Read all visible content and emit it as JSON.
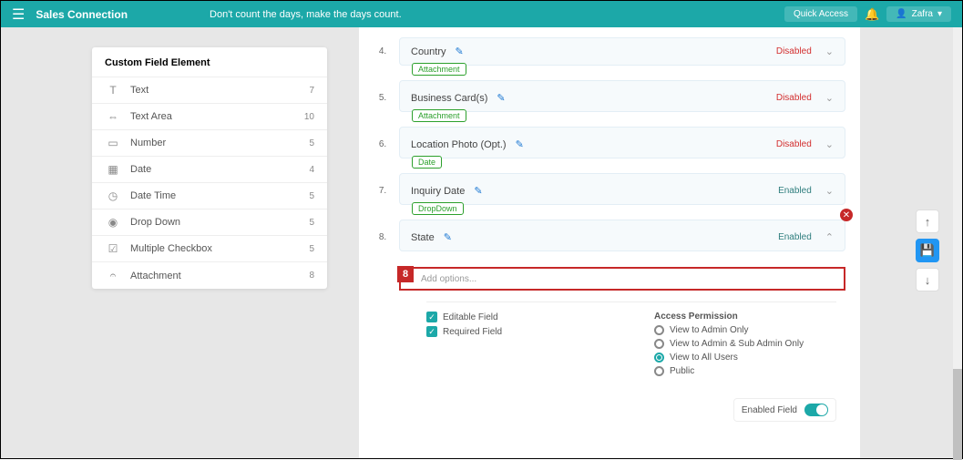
{
  "header": {
    "logo": "Sales Connection",
    "tagline": "Don't count the days, make the days count.",
    "quick_access": "Quick Access",
    "user": "Zafra"
  },
  "sidebar": {
    "title": "Custom Field Element",
    "items": [
      {
        "icon": "T",
        "label": "Text",
        "count": "7"
      },
      {
        "icon": "⇔",
        "label": "Text Area",
        "count": "10"
      },
      {
        "icon": "▭",
        "label": "Number",
        "count": "5"
      },
      {
        "icon": "▦",
        "label": "Date",
        "count": "4"
      },
      {
        "icon": "◷",
        "label": "Date Time",
        "count": "5"
      },
      {
        "icon": "◉",
        "label": "Drop Down",
        "count": "5"
      },
      {
        "icon": "☑",
        "label": "Multiple Checkbox",
        "count": "5"
      },
      {
        "icon": "𝄐",
        "label": "Attachment",
        "count": "8"
      }
    ]
  },
  "fields": [
    {
      "num": "4.",
      "type": "",
      "label": "Country",
      "status": "Disabled",
      "status_class": "status-disabled",
      "chev": "⌄"
    },
    {
      "num": "5.",
      "type": "Attachment",
      "label": "Business Card(s)",
      "status": "Disabled",
      "status_class": "status-disabled",
      "chev": "⌄"
    },
    {
      "num": "6.",
      "type": "Attachment",
      "label": "Location Photo (Opt.)",
      "status": "Disabled",
      "status_class": "status-disabled",
      "chev": "⌄"
    },
    {
      "num": "7.",
      "type": "Date",
      "label": "Inquiry Date",
      "status": "Enabled",
      "status_class": "status-enabled",
      "chev": "⌄"
    },
    {
      "num": "8.",
      "type": "DropDown",
      "label": "State",
      "status": "Enabled",
      "status_class": "status-enabled",
      "chev": "⌃",
      "expanded": true
    }
  ],
  "callout": {
    "num": "8",
    "placeholder": "Add options..."
  },
  "settings": {
    "editable": "Editable Field",
    "required": "Required Field",
    "access_title": "Access Permission",
    "options": [
      {
        "label": "View to Admin Only",
        "selected": false
      },
      {
        "label": "View to Admin & Sub Admin Only",
        "selected": false
      },
      {
        "label": "View to All Users",
        "selected": true
      },
      {
        "label": "Public",
        "selected": false
      }
    ],
    "enabled_label": "Enabled Field"
  }
}
